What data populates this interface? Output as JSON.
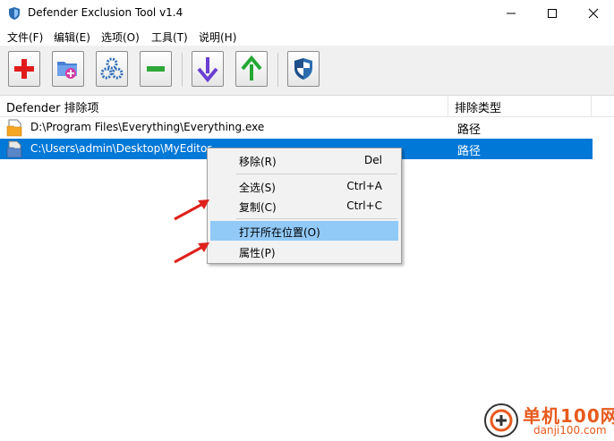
{
  "window": {
    "title": "Defender Exclusion Tool v1.4",
    "controls": {
      "minimize": "—",
      "maximize": "☐",
      "close": "✕"
    }
  },
  "menu": [
    "文件(F)",
    "编辑(E)",
    "选项(O)",
    "工具(T)",
    "说明(H)"
  ],
  "toolbar": [
    {
      "name": "add-button",
      "icon": "red-plus-icon"
    },
    {
      "name": "add-folder-button",
      "icon": "folder-add-icon"
    },
    {
      "name": "add-process-button",
      "icon": "gears-icon"
    },
    {
      "name": "remove-button",
      "icon": "green-minus-icon"
    },
    {
      "name": "import-button",
      "icon": "arrow-down-icon"
    },
    {
      "name": "export-button",
      "icon": "arrow-up-icon"
    },
    {
      "name": "defender-button",
      "icon": "shield-icon"
    }
  ],
  "list": {
    "columns": [
      "Defender 排除项",
      "排除类型"
    ],
    "rows": [
      {
        "path": "D:\\Program Files\\Everything\\Everything.exe",
        "type": "路径",
        "selected": false
      },
      {
        "path": "C:\\Users\\admin\\Desktop\\MyEditor",
        "type": "路径",
        "selected": true
      }
    ]
  },
  "context_menu": {
    "items": [
      {
        "label": "移除(R)",
        "shortcut": "Del"
      },
      {
        "label": "全选(S)",
        "shortcut": "Ctrl+A"
      },
      {
        "label": "复制(C)",
        "shortcut": "Ctrl+C"
      },
      {
        "label": "打开所在位置(O)",
        "shortcut": "",
        "highlighted": true
      },
      {
        "label": "属性(P)",
        "shortcut": ""
      }
    ]
  },
  "watermark": {
    "title": "单机100网",
    "url": "danji100.com"
  },
  "colors": {
    "selection": "#0078d7",
    "menu_highlight": "#91c9f7",
    "arrow": "#e0201b",
    "watermark": "#e85a1d"
  }
}
